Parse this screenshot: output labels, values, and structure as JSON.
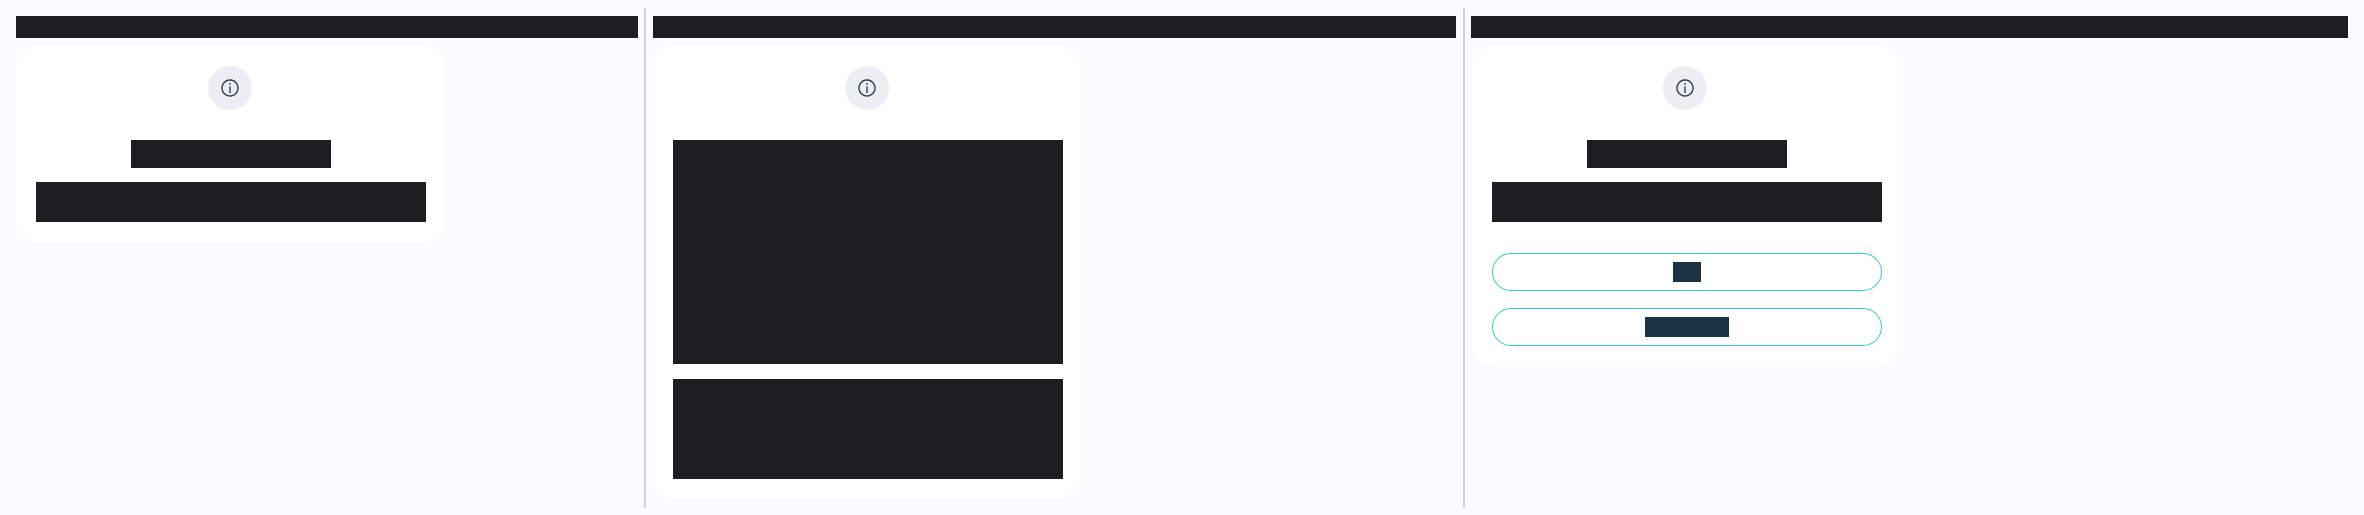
{
  "screens": [
    {
      "header_text": "",
      "dialog": {
        "icon": "info-icon",
        "title": "",
        "message": ""
      }
    },
    {
      "header_text": "",
      "dialog": {
        "icon": "info-icon",
        "title": "",
        "message": ""
      }
    },
    {
      "header_text": "",
      "dialog": {
        "icon": "info-icon",
        "title": "",
        "message": "",
        "buttons": [
          {
            "label": ""
          },
          {
            "label": ""
          }
        ]
      }
    }
  ],
  "colors": {
    "background": "#fafbfd",
    "card": "#ffffff",
    "redaction": "#1d1e20",
    "button_border": "#3fc9cc",
    "button_label_redaction": "#1c3346",
    "icon_stroke": "#2b3f55",
    "icon_circle_bg": "#eceef3",
    "divider": "#cfd3d8"
  }
}
